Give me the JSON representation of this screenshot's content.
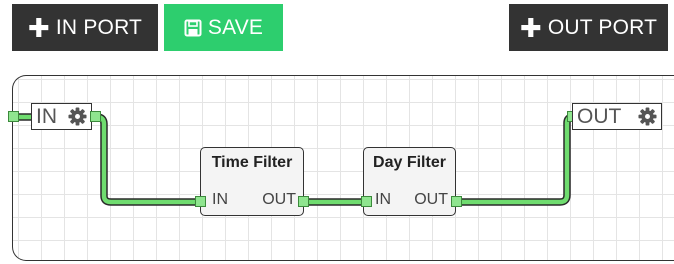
{
  "toolbar": {
    "in_port_label": "IN PORT",
    "save_label": "SAVE",
    "out_port_label": "OUT PORT"
  },
  "icons": {
    "plus": "plus-icon",
    "save": "floppy-disk-icon",
    "gear": "gear-icon"
  },
  "canvas": {
    "in_port": {
      "label": "IN"
    },
    "out_port": {
      "label": "OUT"
    },
    "nodes": [
      {
        "title": "Time Filter",
        "input": "IN",
        "output": "OUT"
      },
      {
        "title": "Day Filter",
        "input": "IN",
        "output": "OUT"
      }
    ]
  },
  "colors": {
    "button_dark": "#333333",
    "button_save": "#2dce6e",
    "wire": "#6fdc6f",
    "wire_outline": "#2a2a2a",
    "port_square": "#8fe58f"
  }
}
